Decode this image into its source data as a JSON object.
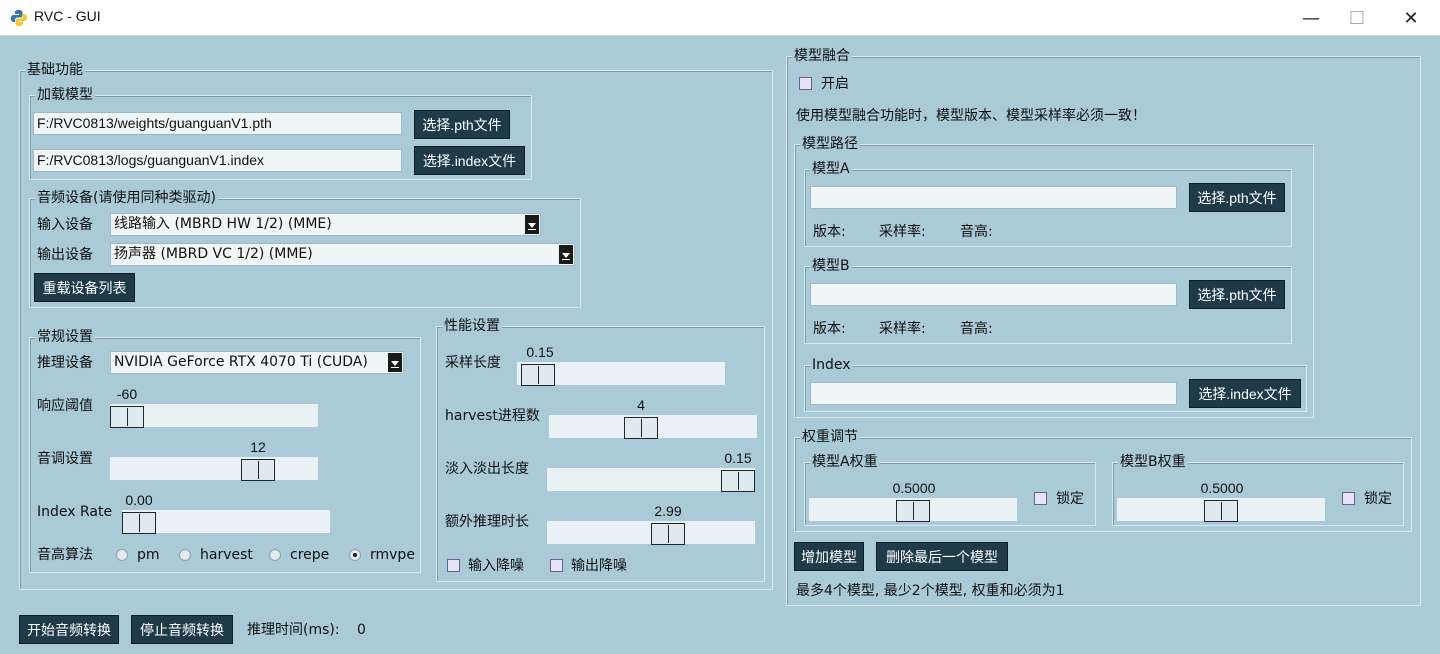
{
  "window": {
    "title": "RVC - GUI",
    "minimize": "—",
    "maximize": "☐",
    "close": "✕"
  },
  "basic": {
    "title": "基础功能",
    "model": {
      "title": "加载模型",
      "pth_path": "F:/RVC0813/weights/guanguanV1.pth",
      "pth_button": "选择.pth文件",
      "index_path": "F:/RVC0813/logs/guanguanV1.index",
      "index_button": "选择.index文件"
    },
    "audio": {
      "title": "音频设备(请使用同种类驱动)",
      "input_label": "输入设备",
      "input_value": "线路输入 (MBRD HW 1/2) (MME)",
      "output_label": "输出设备",
      "output_value": "扬声器 (MBRD VC 1/2) (MME)",
      "reload_button": "重载设备列表"
    }
  },
  "general": {
    "title": "常规设置",
    "device_label": "推理设备",
    "device_value": "NVIDIA GeForce RTX 4070 Ti (CUDA)",
    "threshold": {
      "label": "响应阈值",
      "value": "-60",
      "min": -60,
      "max": 0,
      "current": -60
    },
    "pitch": {
      "label": "音调设置",
      "value": "12",
      "min": -24,
      "max": 24,
      "current": 12
    },
    "index_rate": {
      "label": "Index Rate",
      "value": "0.00",
      "min": 0,
      "max": 1,
      "current": 0
    },
    "f0": {
      "label": "音高算法",
      "options": [
        "pm",
        "harvest",
        "crepe",
        "rmvpe"
      ],
      "selected": "rmvpe"
    }
  },
  "perf": {
    "title": "性能设置",
    "sample": {
      "label": "采样长度",
      "value": "0.15"
    },
    "harvest": {
      "label": "harvest进程数",
      "value": "4"
    },
    "crossfade": {
      "label": "淡入淡出长度",
      "value": "0.15"
    },
    "extra": {
      "label": "额外推理时长",
      "value": "2.99"
    },
    "input_denoise": "输入降噪",
    "output_denoise": "输出降噪"
  },
  "controls": {
    "start_button": "开始音频转换",
    "stop_button": "停止音频转换",
    "infer_time_label": "推理时间(ms):",
    "infer_time_value": "0"
  },
  "merge": {
    "title": "模型融合",
    "enable_label": "开启",
    "notice": "使用模型融合功能时，模型版本、模型采样率必须一致！",
    "paths": {
      "title": "模型路径",
      "model_a": {
        "title": "模型A",
        "path": "",
        "button": "选择.pth文件",
        "version": "版本:",
        "sr": "采样率:",
        "pitch": "音高:"
      },
      "model_b": {
        "title": "模型B",
        "path": "",
        "button": "选择.pth文件",
        "version": "版本:",
        "sr": "采样率:",
        "pitch": "音高:"
      },
      "index": {
        "title": "Index",
        "path": "",
        "button": "选择.index文件"
      }
    },
    "weights": {
      "title": "权重调节",
      "a": {
        "title": "模型A权重",
        "value": "0.5000",
        "lock": "锁定"
      },
      "b": {
        "title": "模型B权重",
        "value": "0.5000",
        "lock": "锁定"
      }
    },
    "add_button": "增加模型",
    "remove_button": "删除最后一个模型",
    "hint": "最多4个模型, 最少2个模型, 权重和必须为1"
  }
}
